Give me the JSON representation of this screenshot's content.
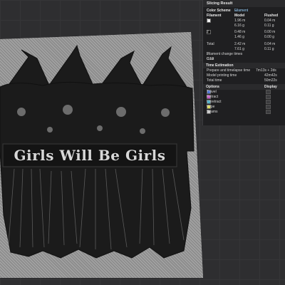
{
  "panel": {
    "title": "Slicing Result",
    "color_scheme_label": "Color Scheme",
    "color_scheme_value": "Filament",
    "columns": [
      "Filament",
      "Model",
      "Flushed"
    ],
    "filaments": [
      {
        "id": "1",
        "color": "#f2f2f2",
        "model_len": "1.96 m",
        "model_wt": "6.16 g",
        "flushed_len": "0.04 m",
        "flushed_wt": "0.11 g"
      },
      {
        "id": "2",
        "color": "#111111",
        "model_len": "0.48 m",
        "model_wt": "1.46 g",
        "flushed_len": "0.00 m",
        "flushed_wt": "0.00 g"
      }
    ],
    "total_label": "Total",
    "total": {
      "model_len": "2.42 m",
      "model_wt": "7.61 g",
      "flushed_len": "0.04 m",
      "flushed_wt": "0.11 g"
    },
    "filament_change_label": "Filament change times",
    "filament_change_value": "2",
    "cost_label": "Cost",
    "cost_value": "0.19",
    "time_title": "Time Estimation",
    "prepare_label": "Prepare and timelapse time",
    "prepare_value": "7m13s + 2ds",
    "model_time_label": "Model printing time",
    "model_time_value": "42m42s",
    "total_time_label": "Total time",
    "total_time_value": "50m22s",
    "options_title": "Options",
    "display_title": "Display",
    "options": [
      {
        "label": "Travel",
        "color": "#3a66d8"
      },
      {
        "label": "Retract",
        "color": "#c23cc2"
      },
      {
        "label": "Unretract",
        "color": "#2fa8c8"
      },
      {
        "label": "Wipe",
        "color": "#e0e040"
      },
      {
        "label": "Seams",
        "color": "#c8c8c8"
      }
    ]
  },
  "model": {
    "banner_text": "Girls Will Be Girls"
  }
}
